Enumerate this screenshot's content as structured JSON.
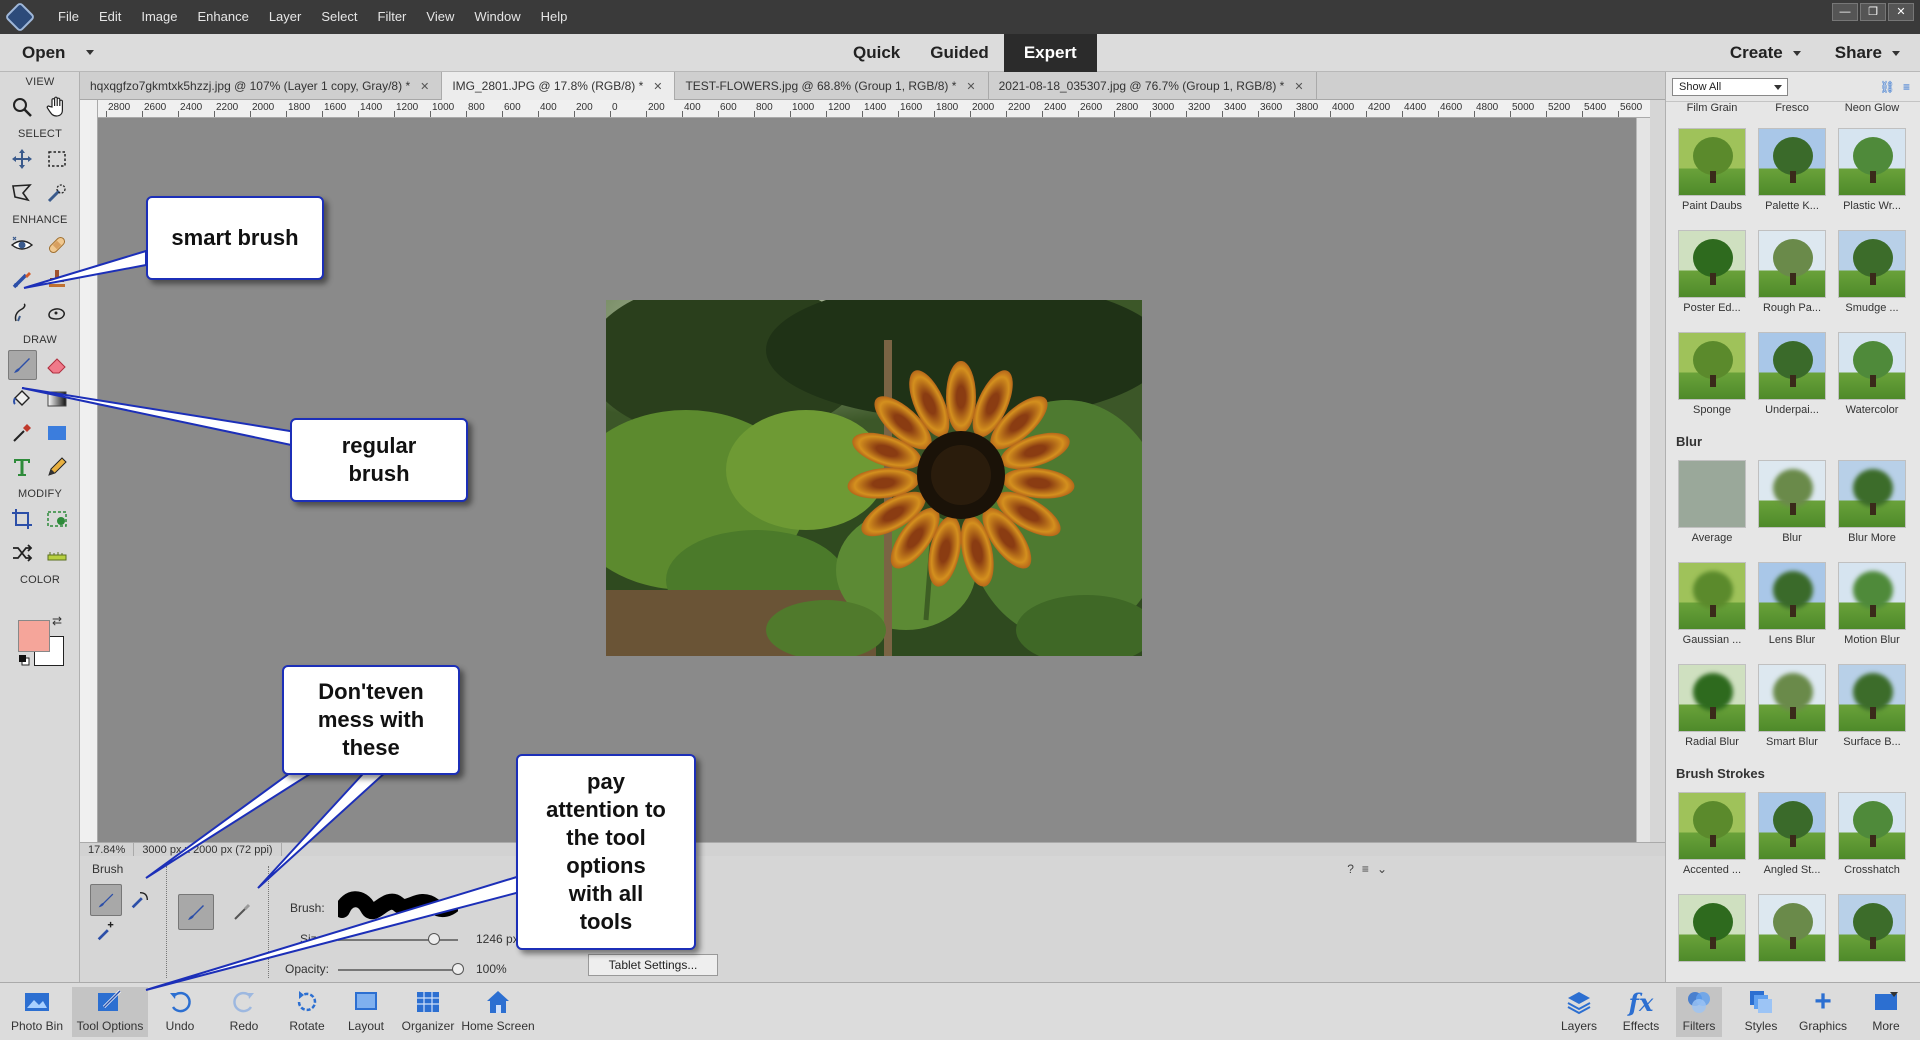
{
  "menubar": {
    "items": [
      "File",
      "Edit",
      "Image",
      "Enhance",
      "Layer",
      "Select",
      "Filter",
      "View",
      "Window",
      "Help"
    ],
    "window_controls": [
      "—",
      "❐",
      "✕"
    ]
  },
  "modebar": {
    "open_label": "Open",
    "modes": [
      "Quick",
      "Guided",
      "Expert"
    ],
    "active_mode": "Expert",
    "create_label": "Create",
    "share_label": "Share"
  },
  "toolbox": {
    "sections": {
      "view": "VIEW",
      "select": "SELECT",
      "enhance": "ENHANCE",
      "draw": "DRAW",
      "modify": "MODIFY",
      "color": "COLOR"
    },
    "foreground_color": "#f5a59a",
    "background_color": "#ffffff"
  },
  "doctabs": [
    {
      "label": "hqxqgfzo7gkmtxk5hzzj.jpg @ 107% (Layer 1 copy, Gray/8) *",
      "active": false
    },
    {
      "label": "IMG_2801.JPG @ 17.8% (RGB/8) *",
      "active": true
    },
    {
      "label": "TEST-FLOWERS.jpg @ 68.8% (Group 1, RGB/8) *",
      "active": false
    },
    {
      "label": "2021-08-18_035307.jpg @ 76.7% (Group 1, RGB/8) *",
      "active": false
    }
  ],
  "ruler": {
    "ticks": [
      "2800",
      "2600",
      "2400",
      "2200",
      "2000",
      "1800",
      "1600",
      "1400",
      "1200",
      "1000",
      "800",
      "600",
      "400",
      "200",
      "0",
      "200",
      "400",
      "600",
      "800",
      "1000",
      "1200",
      "1400",
      "1600",
      "1800",
      "2000",
      "2200",
      "2400",
      "2600",
      "2800",
      "3000",
      "3200",
      "3400",
      "3600",
      "3800",
      "4000",
      "4200",
      "4400",
      "4600",
      "4800",
      "5000",
      "5200",
      "5400",
      "5600"
    ]
  },
  "status": {
    "zoom": "17.84%",
    "dims": "3000 px x 2000 px (72 ppi)"
  },
  "tooloptions": {
    "title": "Brush",
    "brush_label": "Brush:",
    "size_label": "Size:",
    "size_value": "1246 px",
    "opacity_label": "Opacity:",
    "opacity_value": "100%",
    "opacity": 1.0,
    "tablet_button": "Tablet Settings..."
  },
  "rightpanel": {
    "show_label": "Show All",
    "top_names": [
      "Film Grain",
      "Fresco",
      "Neon Glow"
    ],
    "categories": [
      {
        "name": "",
        "items": [
          "Paint Daubs",
          "Palette K...",
          "Plastic Wr...",
          "Poster Ed...",
          "Rough Pa...",
          "Smudge ...",
          "Sponge",
          "Underpai...",
          "Watercolor"
        ]
      },
      {
        "name": "Blur",
        "items": [
          "Average",
          "Blur",
          "Blur More",
          "Gaussian ...",
          "Lens Blur",
          "Motion Blur",
          "Radial Blur",
          "Smart Blur",
          "Surface B..."
        ]
      },
      {
        "name": "Brush Strokes",
        "items": [
          "Accented ...",
          "Angled St...",
          "Crosshatch",
          "",
          "",
          ""
        ]
      }
    ]
  },
  "bottombar": {
    "left": [
      "Photo Bin",
      "Tool Options",
      "Undo",
      "Redo",
      "Rotate",
      "Layout",
      "Organizer",
      "Home Screen"
    ],
    "right": [
      "Layers",
      "Effects",
      "Filters",
      "Styles",
      "Graphics",
      "More"
    ]
  },
  "callouts": {
    "smart_brush": "smart brush",
    "regular_brush_1": "regular",
    "regular_brush_2": "brush",
    "dont_1": "Don'teven",
    "dont_2": "mess with",
    "dont_3": "these",
    "pay_1": "pay",
    "pay_2": "attention to",
    "pay_3": "the tool",
    "pay_4": "options",
    "pay_5": "with all",
    "pay_6": "tools"
  }
}
